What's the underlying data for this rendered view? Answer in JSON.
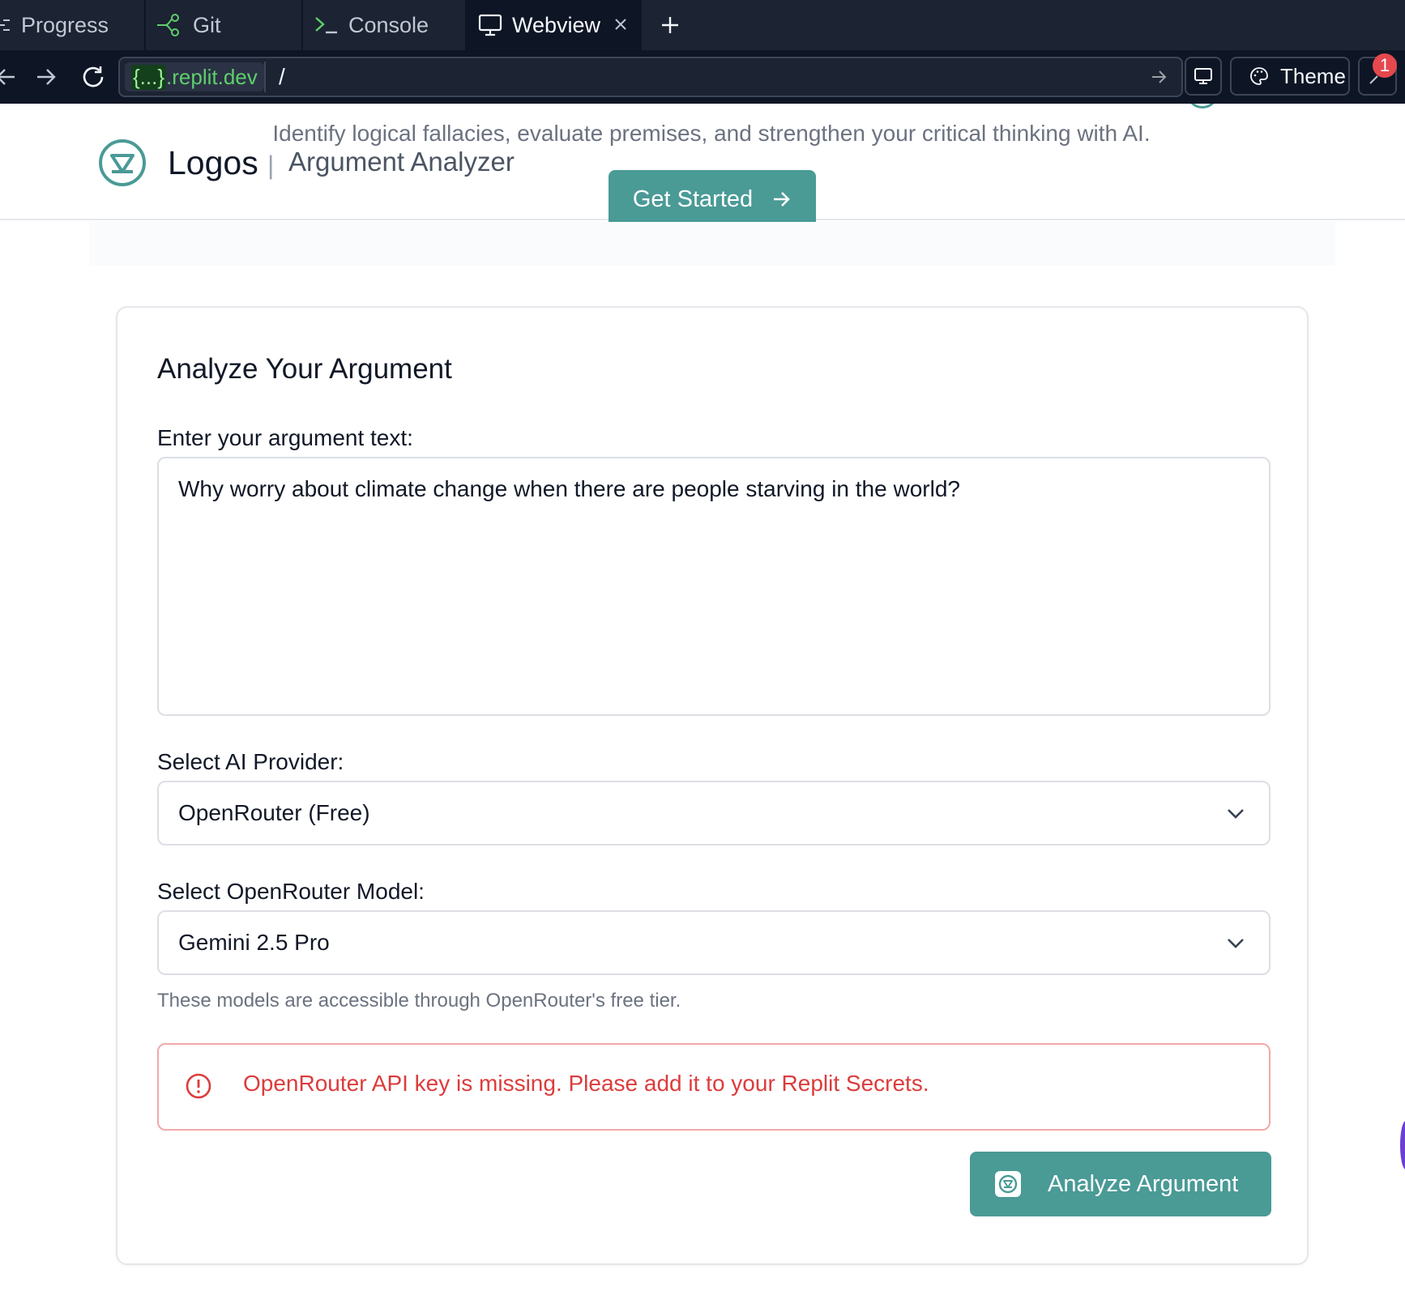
{
  "ide": {
    "tabs": [
      {
        "label": "Progress",
        "icon": "list-icon"
      },
      {
        "label": "Git",
        "icon": "git-branch-icon"
      },
      {
        "label": "Console",
        "icon": "terminal-icon"
      },
      {
        "label": "Webview",
        "icon": "monitor-icon",
        "active": true
      }
    ],
    "url": {
      "domain_prefix": "{...}",
      "domain_suffix": ".replit.dev",
      "path": "/"
    },
    "theme_label": "Theme",
    "notification_count": "1"
  },
  "header": {
    "brand": "Logos",
    "separator": "|",
    "subtitle": "Argument Analyzer",
    "hero_subtitle": "Identify logical fallacies, evaluate premises, and strengthen your critical thinking with AI.",
    "cta_label": "Get Started"
  },
  "form": {
    "title": "Analyze Your Argument",
    "argument_label": "Enter your argument text:",
    "argument_value": "Why worry about climate change when there are people starving in the world?",
    "provider_label": "Select AI Provider:",
    "provider_value": "OpenRouter (Free)",
    "model_label": "Select OpenRouter Model:",
    "model_value": "Gemini 2.5 Pro",
    "model_helper": "These models are accessible through OpenRouter's free tier.",
    "error_message": "OpenRouter API key is missing. Please add it to your Replit Secrets.",
    "submit_label": "Analyze Argument"
  },
  "colors": {
    "accent": "#4a9a96",
    "error": "#dc3c3c",
    "ide_bg": "#1c2333"
  }
}
